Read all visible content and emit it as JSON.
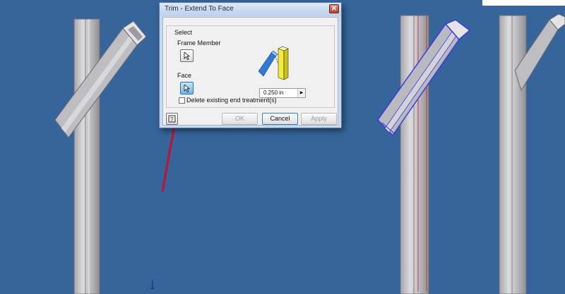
{
  "dialog": {
    "title": "Trim - Extend To Face",
    "close_icon": "close-icon",
    "group_label": "Select",
    "frame_member_label": "Frame Member",
    "face_label": "Face",
    "offset_value": "0.250 in",
    "delete_treatment_label": "Delete existing end treatment(s)",
    "delete_treatment_checked": false,
    "ok_label": "OK",
    "cancel_label": "Cancel",
    "apply_label": "Apply",
    "face_selector_active": true,
    "ok_enabled": false,
    "apply_enabled": false
  },
  "colors": {
    "viewport_background": "#35659b",
    "highlight_edge": "#3a3adc",
    "selected_face_line": "#cc3a3a",
    "annotation_arrow": "#c8102e"
  }
}
